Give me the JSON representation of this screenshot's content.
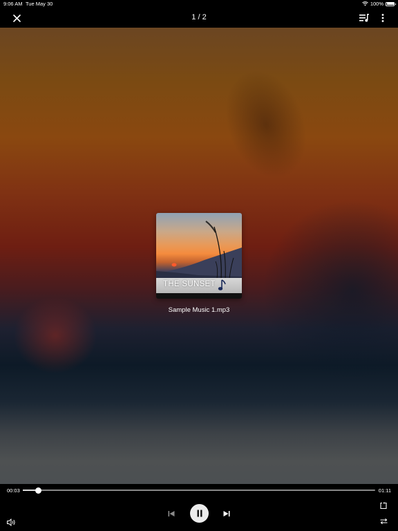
{
  "status_bar": {
    "time": "9:06 AM",
    "date": "Tue May 30",
    "battery": "100%"
  },
  "top_bar": {
    "counter": "1 / 2"
  },
  "album_art": {
    "banner_text": "THE SUNSET"
  },
  "track": {
    "name": "Sample Music 1.mp3"
  },
  "player": {
    "current_time": "00:03",
    "total_time": "01:11",
    "progress_fraction": 0.045
  },
  "colors": {
    "controls_bg": "#000000",
    "play_button_bg": "#ececec"
  },
  "icons": {
    "close": "close-icon",
    "playlist": "playlist-icon",
    "more": "more-vertical-icon",
    "previous": "skip-previous-icon",
    "pause": "pause-icon",
    "next": "skip-next-icon",
    "volume": "volume-icon",
    "repeat": "repeat-icon",
    "shuffle": "shuffle-icon"
  }
}
